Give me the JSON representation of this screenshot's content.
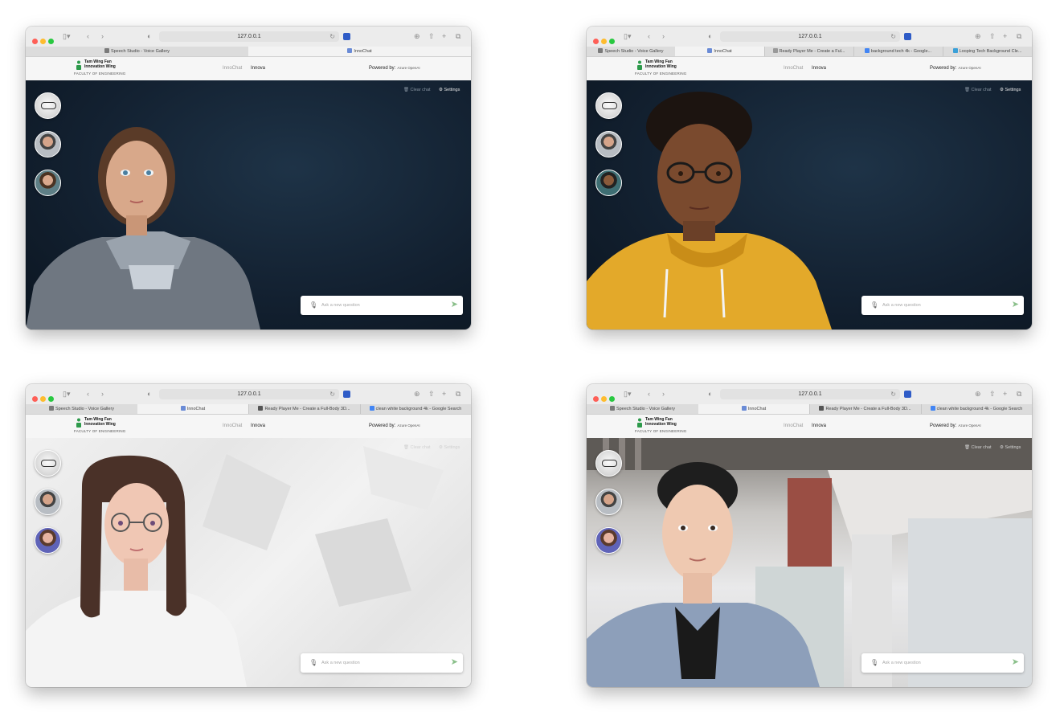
{
  "browser": {
    "url": "127.0.0.1",
    "tabs_short": [
      "Speech Studio - Voice Gallery",
      "InnoChat"
    ],
    "tabs_w2": [
      "Speech Studio - Voice Gallery",
      "InnoChat",
      "Ready Player Me - Create a Ful...",
      "background tech 4k - Google...",
      "Looping Tech Background Cle..."
    ],
    "tabs_long": [
      "Speech Studio - Voice Gallery",
      "InnoChat",
      "Ready Player Me - Create a Full-Body 3D...",
      "clean white background 4k - Google Search"
    ]
  },
  "header": {
    "logo_line1": "Tam Wing Fan",
    "logo_line2": "Innovation Wing",
    "logo_line3": "FACULTY OF ENGINEERING",
    "nav_innochat": "InnoChat",
    "nav_innova": "Innova",
    "powered_by": "Powered by:",
    "powered_value": "Azure OpenAI"
  },
  "controls": {
    "clear_chat": "Clear chat",
    "settings": "Settings"
  },
  "chat": {
    "placeholder": "Ask a new question"
  },
  "icons": {
    "microphone": "mic-icon",
    "send": "send-icon",
    "trash": "trash-icon",
    "gear": "gear-icon"
  },
  "colors": {
    "dark_stage": "#132131",
    "send_accent": "#8bc08b"
  }
}
